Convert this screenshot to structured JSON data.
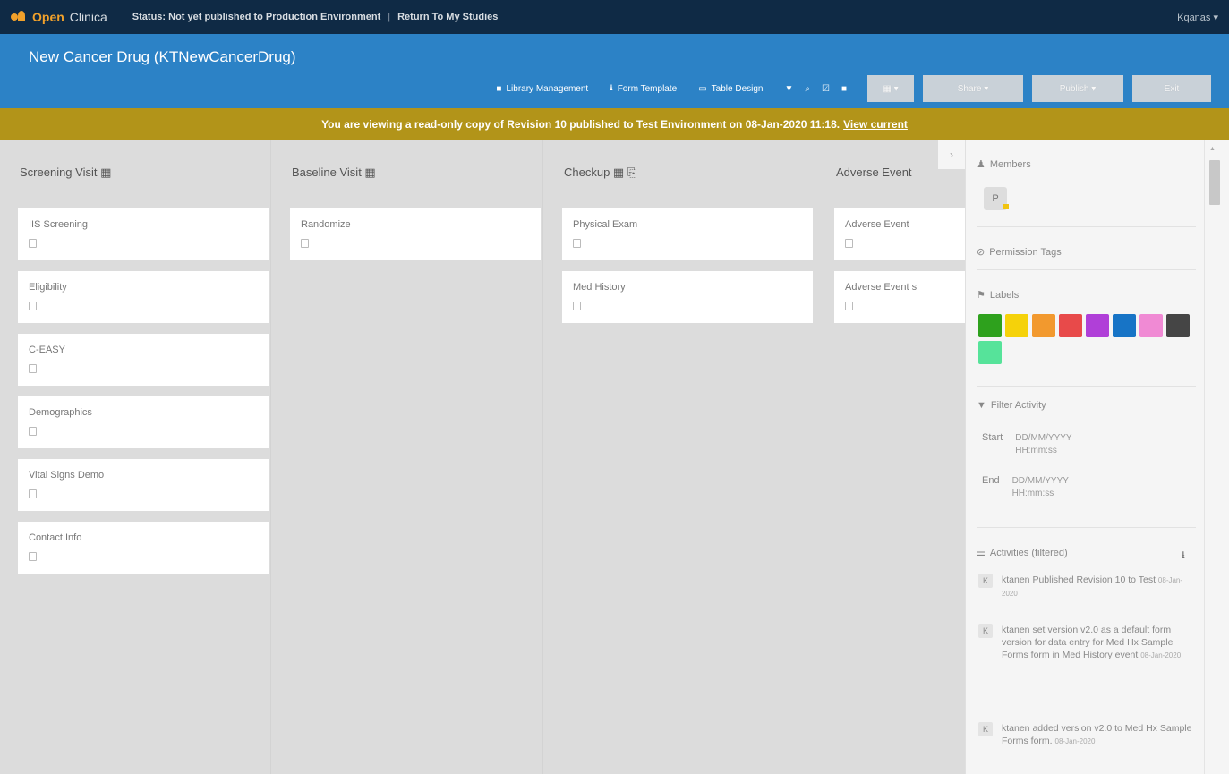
{
  "topnav": {
    "logo_open": "Open",
    "logo_clinica": "Clinica",
    "status": "Status: Not yet published to Production Environment",
    "separator": "|",
    "return_link": "Return To My Studies",
    "user_menu": "Kqanas ▾"
  },
  "header": {
    "study_title": "New Cancer Drug (KTNewCancerDrug)",
    "toolbar": {
      "library": "Library Management",
      "form_template": "Form Template",
      "table_design": "Table Design",
      "view_btn": "▦ ▾",
      "share_btn": "Share ▾",
      "publish_btn": "Publish ▾",
      "exit_btn": "Exit"
    }
  },
  "banner": {
    "text": "You are viewing a read-only copy of Revision 10 published to Test Environment on 08-Jan-2020 11:18.",
    "view_current": "View current"
  },
  "columns": [
    {
      "title": "Screening Visit ▦",
      "cards": [
        "IIS Screening",
        "Eligibility",
        "C-EASY",
        "Demographics",
        "Vital Signs Demo",
        "Contact Info"
      ]
    },
    {
      "title": "Baseline Visit ▦",
      "cards": [
        "Randomize"
      ]
    },
    {
      "title": "Checkup ▦ ⎘",
      "cards": [
        "Physical Exam",
        "Med History"
      ]
    },
    {
      "title": "Adverse Event",
      "cards": [
        "Adverse Event",
        "Adverse Event s"
      ]
    }
  ],
  "panel": {
    "toggle": "›",
    "members_title": "Members",
    "member_initial": "P",
    "permission_tags_title": "Permission Tags",
    "labels_title": "Labels",
    "label_colors": [
      "#2ea11d",
      "#f5d20a",
      "#f2992e",
      "#e84a4a",
      "#b03fd8",
      "#1774c6",
      "#f08ad4",
      "#454545",
      "#56e39a"
    ],
    "filter_title": "Filter Activity",
    "filter_start_label": "Start",
    "filter_start_date": "DD/MM/YYYY",
    "filter_start_time": "HH:mm:ss",
    "filter_end_label": "End",
    "filter_end_date": "DD/MM/YYYY",
    "filter_end_time": "HH:mm:ss",
    "activities_title": "Activities (filtered)",
    "activities": [
      {
        "text": "ktanen Published Revision 10 to Test",
        "time": "08-Jan-2020"
      },
      {
        "text": "ktanen set version v2.0 as a default form version for data entry for Med Hx Sample Forms form in Med History event",
        "time": "08-Jan-2020"
      },
      {
        "text": "ktanen added version v2.0 to Med Hx Sample Forms form.",
        "time": "08-Jan-2020"
      }
    ]
  }
}
